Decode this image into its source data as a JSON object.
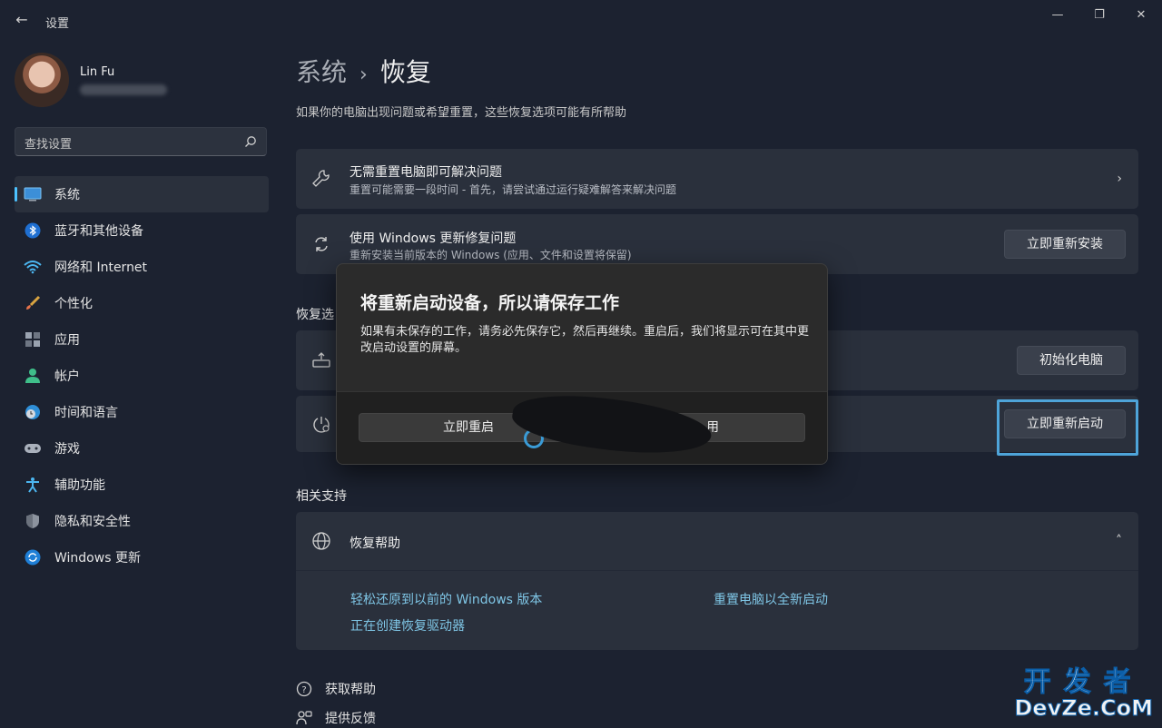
{
  "window": {
    "title": "设置",
    "back_glyph": "←",
    "minimize_glyph": "—",
    "maximize_glyph": "❐",
    "close_glyph": "✕"
  },
  "profile": {
    "name": "Lin Fu"
  },
  "search": {
    "placeholder": "查找设置",
    "icon": "search-icon"
  },
  "nav": {
    "items": [
      {
        "label": "系统",
        "icon": "monitor-icon",
        "active": true
      },
      {
        "label": "蓝牙和其他设备",
        "icon": "bluetooth-icon"
      },
      {
        "label": "网络和 Internet",
        "icon": "wifi-icon"
      },
      {
        "label": "个性化",
        "icon": "brush-icon"
      },
      {
        "label": "应用",
        "icon": "apps-icon"
      },
      {
        "label": "帐户",
        "icon": "person-icon"
      },
      {
        "label": "时间和语言",
        "icon": "clock-globe-icon"
      },
      {
        "label": "游戏",
        "icon": "gamepad-icon"
      },
      {
        "label": "辅助功能",
        "icon": "accessibility-icon"
      },
      {
        "label": "隐私和安全性",
        "icon": "shield-icon"
      },
      {
        "label": "Windows 更新",
        "icon": "update-icon"
      }
    ]
  },
  "main": {
    "breadcrumb": {
      "parent": "系统",
      "separator": "›",
      "current": "恢复"
    },
    "subtitle": "如果你的电脑出现问题或希望重置，这些恢复选项可能有所帮助",
    "cards": {
      "troubleshoot": {
        "title": "无需重置电脑即可解决问题",
        "desc": "重置可能需要一段时间 - 首先，请尝试通过运行疑难解答来解决问题",
        "icon": "wrench-icon",
        "chevron": "›"
      },
      "windows_update_fix": {
        "title": "使用 Windows 更新修复问题",
        "desc": "重新安装当前版本的 Windows (应用、文件和设置将保留)",
        "icon": "sync-icon",
        "button": "立即重新安装"
      },
      "reset_pc": {
        "icon": "reset-pc-icon",
        "button": "初始化电脑"
      },
      "advanced_startup": {
        "icon": "advanced-startup-icon",
        "button": "立即重新启动"
      }
    },
    "recovery_section_label": "恢复选",
    "related_support": {
      "label": "相关支持",
      "card_title": "恢复帮助",
      "card_icon": "globe-icon",
      "chevron": "˄",
      "links": [
        "轻松还原到以前的 Windows 版本",
        "重置电脑以全新启动",
        "正在创建恢复驱动器"
      ]
    },
    "footer": [
      {
        "label": "获取帮助",
        "icon": "help-icon"
      },
      {
        "label": "提供反馈",
        "icon": "feedback-icon"
      }
    ]
  },
  "dialog": {
    "title": "将重新启动设备，所以请保存工作",
    "body": "如果有未保存的工作，请务必先保存它，然后再继续。重启后，我们将显示可在其中更改启动设置的屏幕。",
    "primary_button": "立即重启",
    "secondary_button_visible_fragment": "用"
  },
  "watermark": {
    "top": "开发者",
    "bottom": "DevZe.CoM"
  },
  "colors": {
    "background": "#1c2230",
    "card": "#2a303c",
    "accent": "#4cc2ff",
    "link": "#7fc6e6",
    "focus_ring": "#4ea4d9",
    "dialog_bg": "#2b2b2b"
  }
}
